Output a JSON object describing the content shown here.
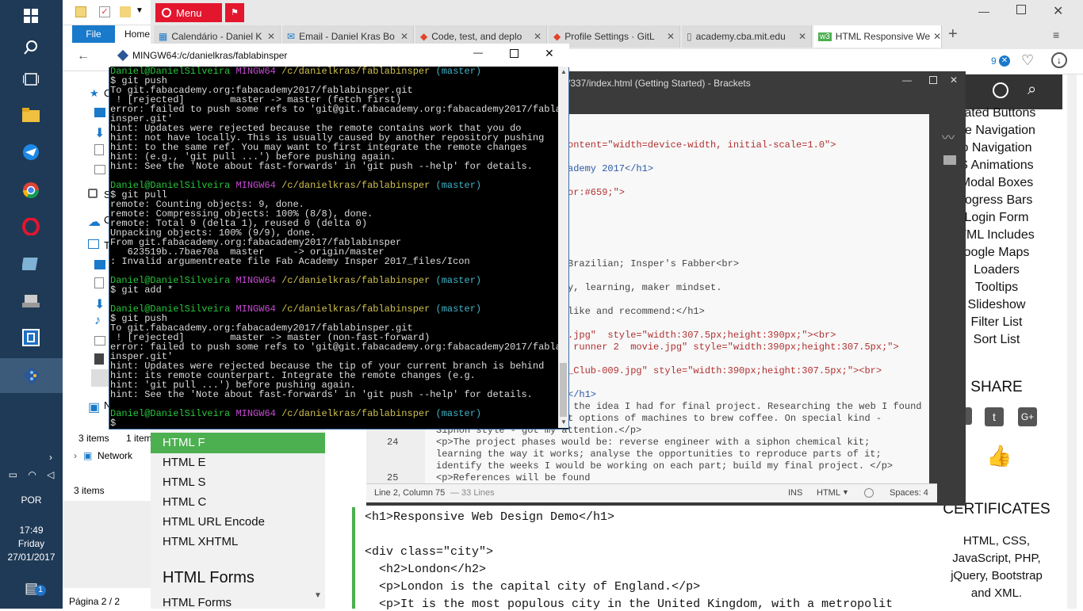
{
  "taskbar": {
    "lang": "POR",
    "time": "17:49",
    "day": "Friday",
    "date": "27/01/2017",
    "notifications": "1"
  },
  "explorer": {
    "file_tab": "File",
    "home_tab": "Home",
    "items1": "3 items",
    "items2": "1 item",
    "items3": "3 items",
    "network": "Network",
    "page": "Página 2 / 2",
    "n_letter": "N",
    "c_letter": "C",
    "c_letter2": "C",
    "t_letter": "T",
    "s_letter": "S"
  },
  "browser": {
    "menu": "Menu",
    "tabs": [
      {
        "label": "Calendário - Daniel K"
      },
      {
        "label": "Email - Daniel Kras Bo"
      },
      {
        "label": "Code, test, and deplo"
      },
      {
        "label": "Profile Settings · GitL"
      },
      {
        "label": "academy.cba.mit.edu"
      },
      {
        "label": "HTML Responsive We"
      }
    ],
    "new_tab": "+",
    "badge": "9",
    "right_nav": [
      "nated Buttons",
      "de Navigation",
      "p Navigation",
      "S Animations",
      "Modal Boxes",
      "rogress Bars",
      "Login Form",
      "TML Includes",
      "oogle Maps",
      "Loaders",
      "Tooltips",
      "Slideshow",
      "Filter List",
      "Sort List"
    ],
    "share": "SHARE",
    "certificates": "CERTIFICATES",
    "cert_text": [
      "HTML, CSS,",
      "JavaScript, PHP,",
      "jQuery, Bootstrap",
      "and XML."
    ],
    "left_nav": [
      "HTML F",
      "HTML E",
      "HTML S",
      "HTML C",
      "HTML URL Encode",
      "HTML XHTML"
    ],
    "forms_heading": "HTML Forms",
    "forms_item": "HTML Forms",
    "code_lines": [
      "<h1>Responsive Web Design Demo</h1>",
      "",
      "<div class=\"city\">",
      "  <h2>London</h2>",
      "  <p>London is the capital city of England.</p>",
      "  <p>It is the most populous city in the United Kingdom, with a metropolit"
    ]
  },
  "brackets": {
    "title": "/337/index.html (Getting Started) - Brackets",
    "lines": [
      {
        "n": "",
        "t": "ontent=\"width=device-width, initial-scale=1.0\">"
      },
      {
        "n": "",
        "t": "ademy 2017</h1>"
      },
      {
        "n": "",
        "t": "or:#659;\">"
      },
      {
        "n": "",
        "t": "Brazilian; Insper's Fabber<br>"
      },
      {
        "n": "",
        "t": "y, learning, maker mindset."
      },
      {
        "n": "",
        "t": "like and recommend:</h1>"
      },
      {
        "n": "",
        "t": ".jpg\"  style=\"width:307.5px;height:390px;\"><br>"
      },
      {
        "n": "",
        "t": " runner 2  movie.jpg\" style=\"width:390px;height:307.5px;\">"
      },
      {
        "n": "",
        "t": "_Club-009.jpg\" style=\"width:390px;height:307.5px;\"><br>"
      },
      {
        "n": "",
        "t": "</h1>"
      },
      {
        "n": "",
        "t": " the idea I had for final project. Researching the web I found"
      },
      {
        "n": "",
        "t": "t options of machines to brew coffee. On special kind -"
      },
      {
        "n": "",
        "t": "Siphon style - got my attention.</p>"
      },
      {
        "n": "24",
        "t": "<p>The project phases would be: reverse engineer with a siphon chemical kit;"
      },
      {
        "n": "",
        "t": "learning the way it works; analyse the opportunities to reproduce parts of it;"
      },
      {
        "n": "",
        "t": "identify the weeks I would be working on each part; build my final project. </p>"
      },
      {
        "n": "25",
        "t": "<p>References will be found"
      }
    ],
    "status_pos": "Line 2, Column 75",
    "status_lines": "— 33 Lines",
    "ins": "INS",
    "lang": "HTML",
    "spaces": "Spaces: 4"
  },
  "terminal": {
    "title": "MINGW64:/c/danielkras/fablabinsper",
    "prompt_user": "Daniel@DanielSilveira",
    "prompt_host": "MINGW64",
    "prompt_path": "/c/danielkras/fablabinsper",
    "prompt_branch": "(master)",
    "block1": [
      "$ git push",
      "To git.fabacademy.org:fabacademy2017/fablabinsper.git",
      " ! [rejected]        master -> master (fetch first)",
      "error: failed to push some refs to 'git@git.fabacademy.org:fabacademy2017/fablab",
      "insper.git'",
      "hint: Updates were rejected because the remote contains work that you do",
      "hint: not have locally. This is usually caused by another repository pushing",
      "hint: to the same ref. You may want to first integrate the remote changes",
      "hint: (e.g., 'git pull ...') before pushing again.",
      "hint: See the 'Note about fast-forwards' in 'git push --help' for details."
    ],
    "block2": [
      "$ git pull",
      "remote: Counting objects: 9, done.",
      "remote: Compressing objects: 100% (8/8), done.",
      "remote: Total 9 (delta 1), reused 0 (delta 0)",
      "Unpacking objects: 100% (9/9), done.",
      "From git.fabacademy.org:fabacademy2017/fablabinsper",
      "   623519b..7bae70a  master     -> origin/master",
      ": Invalid argumentreate file Fab Academy Insper 2017_files/Icon"
    ],
    "block3": [
      "$ git add *"
    ],
    "block4": [
      "$ git push",
      "To git.fabacademy.org:fabacademy2017/fablabinsper.git",
      " ! [rejected]        master -> master (non-fast-forward)",
      "error: failed to push some refs to 'git@git.fabacademy.org:fabacademy2017/fablab",
      "insper.git'",
      "hint: Updates were rejected because the tip of your current branch is behind",
      "hint: its remote counterpart. Integrate the remote changes (e.g.",
      "hint: 'git pull ...') before pushing again.",
      "hint: See the 'Note about fast-forwards' in 'git push --help' for details."
    ],
    "last_prompt": "$"
  }
}
